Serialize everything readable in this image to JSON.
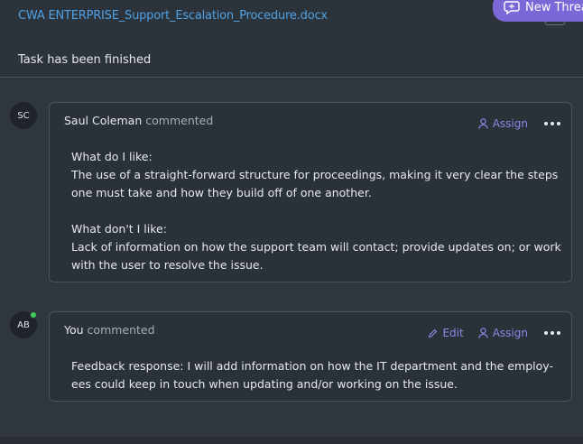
{
  "task": {
    "file_link": "CWA ENTERPRISE_Support_Escalation_Procedure.docx",
    "status": "Task has been finished"
  },
  "new_thread_button": {
    "label": "New Thread",
    "icon": "chat-plus-icon",
    "color": "#7b68d8"
  },
  "comments": [
    {
      "avatar_initials": "SC",
      "author": "Saul Coleman",
      "action": "commented",
      "actions": {
        "assign_label": "Assign"
      },
      "body": [
        "What do I like:",
        "The use of a straight-forward structure for proceedings, making it very clear the steps",
        "one must take and how they build off of one another.",
        "",
        "What don't I like:",
        "Lack of information on how the support team will contact; provide updates on; or work",
        "with the user to resolve the issue."
      ]
    },
    {
      "avatar_initials": "AB",
      "online": true,
      "author": "You",
      "action": "commented",
      "actions": {
        "edit_label": "Edit",
        "assign_label": "Assign"
      },
      "body": [
        "Feedback response: I will add information on how the IT department and the employ-",
        "ees could keep in touch when updating and/or working on the issue."
      ]
    }
  ],
  "colors": {
    "accent": "#8f86e6",
    "link": "#4ea1e4",
    "online": "#3ccf5a"
  }
}
